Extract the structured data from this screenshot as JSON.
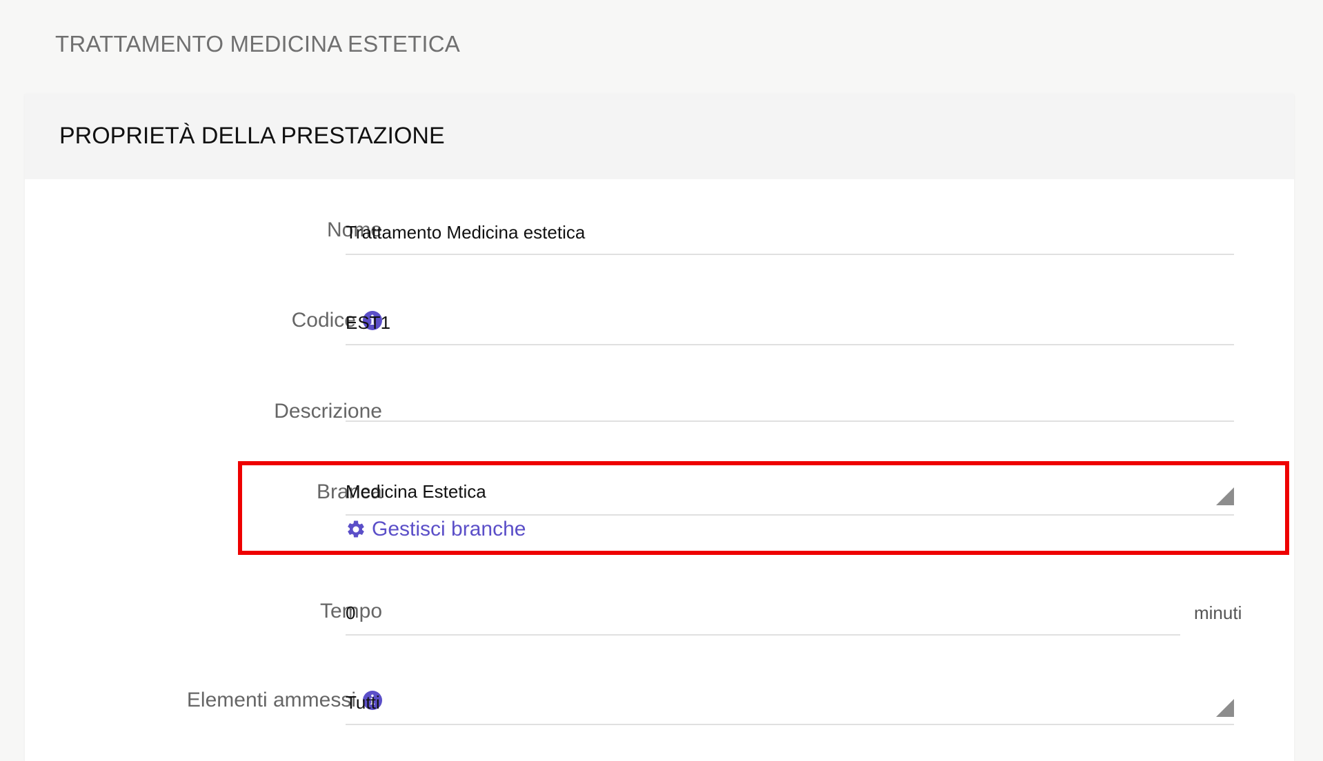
{
  "page": {
    "title": "TRATTAMENTO MEDICINA ESTETICA"
  },
  "card": {
    "title": "PROPRIETÀ DELLA PRESTAZIONE"
  },
  "form": {
    "nome": {
      "label": "Nome",
      "value": "Trattamento Medicina estetica"
    },
    "codice": {
      "label": "Codice",
      "value": "EST1",
      "info_icon": "info-icon"
    },
    "descrizione": {
      "label": "Descrizione",
      "value": ""
    },
    "branca": {
      "label": "Branca",
      "value": "Medicina Estetica",
      "manage_label": "Gestisci branche",
      "manage_icon": "gear-icon"
    },
    "tempo": {
      "label": "Tempo",
      "value": "0",
      "unit": "minuti"
    },
    "elementi_ammessi": {
      "label": "Elementi ammessi",
      "value": "Tutti",
      "info_icon": "info-icon"
    }
  },
  "colors": {
    "accent": "#5b4fc8",
    "highlight": "#ee0000",
    "background": "#f7f7f6"
  }
}
